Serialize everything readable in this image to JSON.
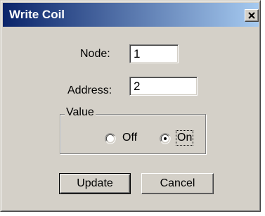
{
  "window": {
    "title": "Write Coil",
    "close_icon": "close-icon"
  },
  "form": {
    "node_label": "Node:",
    "node_value": "1",
    "address_label": "Address:",
    "address_value": "2"
  },
  "value_group": {
    "legend": "Value",
    "options": [
      {
        "label": "Off",
        "selected": false
      },
      {
        "label": "On",
        "selected": true
      }
    ]
  },
  "buttons": {
    "update_label": "Update",
    "cancel_label": "Cancel"
  },
  "colors": {
    "titlebar_start": "#0a246a",
    "titlebar_end": "#a6caf0",
    "dialog_face": "#d4d0c8"
  }
}
